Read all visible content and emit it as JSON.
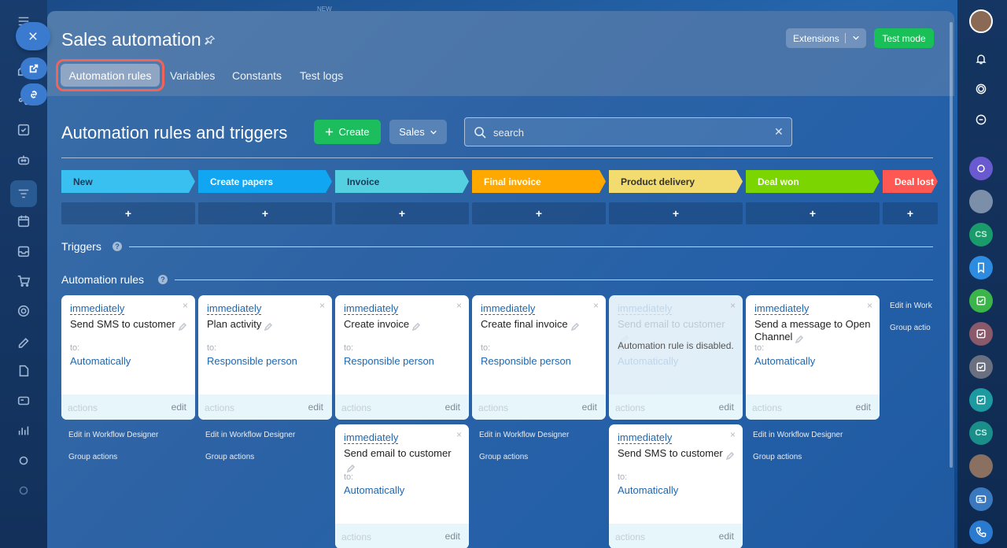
{
  "slider": {
    "title": "Sales automation",
    "extensions_label": "Extensions",
    "test_mode_label": "Test mode",
    "tabs": [
      "Automation rules",
      "Variables",
      "Constants",
      "Test logs"
    ]
  },
  "topstrip": {
    "new_label": "NEW"
  },
  "toolbar": {
    "section_title": "Automation rules and triggers",
    "create_label": "Create",
    "sales_label": "Sales",
    "search_placeholder": "search"
  },
  "stages": [
    {
      "label": "New",
      "color": "#39c0f0",
      "text": "#1d3b5a"
    },
    {
      "label": "Create papers",
      "color": "#10a6f2",
      "text": "#ffffff"
    },
    {
      "label": "Invoice",
      "color": "#55d0e0",
      "text": "#1d3b5a"
    },
    {
      "label": "Final invoice",
      "color": "#ffa900",
      "text": "#ffffff"
    },
    {
      "label": "Product delivery",
      "color": "#f2dc6f",
      "text": "#333333"
    },
    {
      "label": "Deal won",
      "color": "#7bd500",
      "text": "#ffffff"
    },
    {
      "label": "Deal lost",
      "color": "#ff5752",
      "text": "#ffffff"
    }
  ],
  "stage_add_label": "+",
  "triggers_label": "Triggers",
  "rules_label": "Automation rules",
  "help_glyph": "?",
  "card_common": {
    "actions": "actions",
    "edit": "edit",
    "to": "to:",
    "close": "×",
    "disabled_msg": "Automation rule is disabled."
  },
  "cards": [
    {
      "delay": "immediately",
      "name": "Send SMS to customer",
      "target": "Automatically"
    },
    {
      "delay": "immediately",
      "name": "Plan activity",
      "target": "Responsible person"
    },
    {
      "delay": "immediately",
      "name": "Create invoice",
      "target": "Responsible person"
    },
    {
      "delay": "immediately",
      "name": "Create final invoice",
      "target": "Responsible person"
    },
    {
      "delay": "immediately",
      "name": "Send email to customer",
      "target": "Automatically"
    },
    {
      "delay": "immediately",
      "name": "Send a message to Open Channel",
      "target": "Automatically"
    },
    {
      "delay": "immediately",
      "name": "Send email to customer",
      "target": "Automatically"
    },
    {
      "delay": "immediately",
      "name": "Send SMS to customer",
      "target": "Automatically"
    }
  ],
  "col_links": {
    "workflow": "Edit in Workflow Designer",
    "group": "Group actions",
    "workflow_short": "Edit in Work",
    "group_short": "Group actio"
  },
  "rightbar": {
    "cs_label": "CS"
  }
}
